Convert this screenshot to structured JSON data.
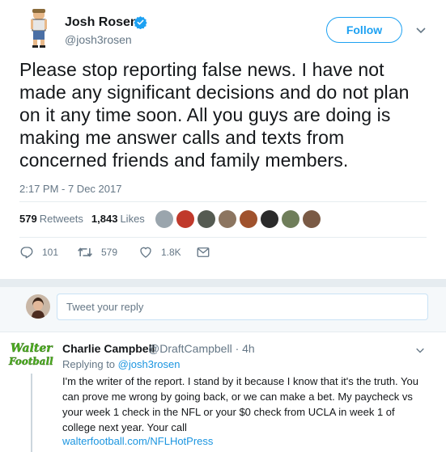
{
  "tweet": {
    "author_name": "Josh Rosen",
    "handle": "@josh3rosen",
    "follow_label": "Follow",
    "text": "Please stop reporting false news. I have not made any significant decisions and do not plan on it any time soon. All you guys are doing is making me answer calls and texts from concerned friends and family members.",
    "timestamp": "2:17 PM - 7 Dec 2017",
    "stats": {
      "retweets_count": "579",
      "retweets_label": "Retweets",
      "likes_count": "1,843",
      "likes_label": "Likes"
    },
    "actions": {
      "reply_count": "101",
      "retweet_count": "579",
      "like_count": "1.8K"
    }
  },
  "reply_box": {
    "placeholder": "Tweet your reply"
  },
  "reply": {
    "author_name": "Charlie Campbell",
    "handle_time": "@DraftCampbell · 4h",
    "replying_prefix": "Replying to",
    "replying_handle": "@josh3rosen",
    "text": "I'm the writer of the report. I stand by it because I know that it's the truth. You can prove me wrong by going back, or we can make a bet. My paycheck vs your week 1 check in the NFL or your $0 check from UCLA in week 1 of college next year. Your call",
    "url": "walterfootball.com/NFLHotPress",
    "logo_text_1": "Walter",
    "logo_text_2": "Football"
  },
  "colors": {
    "accent": "#1da1f2",
    "link": "#1b95e0",
    "muted": "#657786",
    "logo_green": "#4caf1f"
  }
}
